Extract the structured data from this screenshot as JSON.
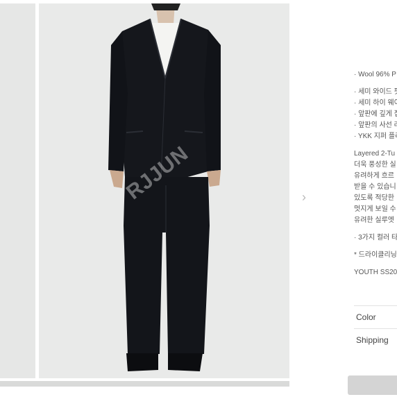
{
  "watermark": "RJJUN",
  "gallery": {
    "next_arrow": "›"
  },
  "description": {
    "material": "· Wool 96% P",
    "features": [
      "· 세미 와이드 핏",
      "· 세미 하이 웨이",
      "· 앞판에 깊게 접",
      "· 앞판의 사선 라",
      "· YKK 지퍼 플라"
    ],
    "paragraph_lines": [
      "Layered 2-Tu",
      "더욱 풍성한 실",
      "유려하게 흐르",
      "받을 수 있습니",
      "있도록 적당한",
      "멋지게 보일 수",
      "유려한 실루엣"
    ],
    "colors_note": "· 3가지 컬러 타",
    "care_note": "* 드라이클리닝",
    "season": "YOUTH SS20"
  },
  "options": {
    "color_label": "Color",
    "shipping_label": "Shipping"
  },
  "colors": {
    "suit": "#15171c",
    "shirt": "#f4f4f2",
    "background": "#e9eae9"
  }
}
